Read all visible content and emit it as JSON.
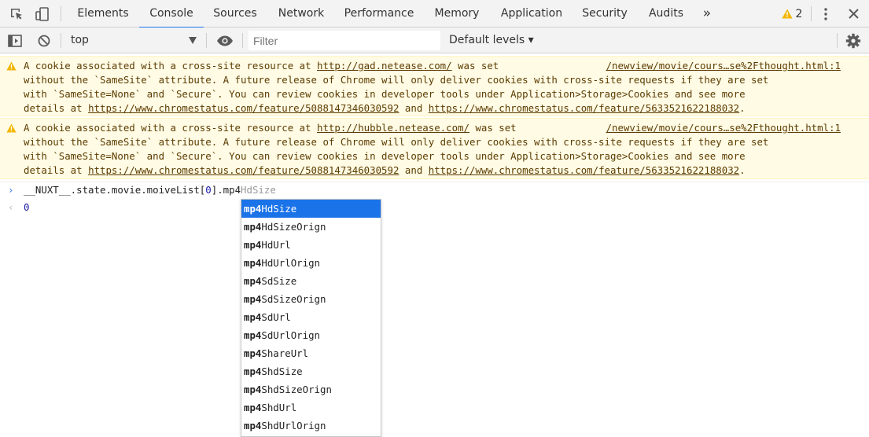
{
  "tabbar": {
    "tabs": [
      {
        "label": "Elements"
      },
      {
        "label": "Console"
      },
      {
        "label": "Sources"
      },
      {
        "label": "Network"
      },
      {
        "label": "Performance"
      },
      {
        "label": "Memory"
      },
      {
        "label": "Application"
      },
      {
        "label": "Security"
      },
      {
        "label": "Audits"
      }
    ],
    "active_tab": "Console",
    "overflow_label": "»",
    "warning_count": "2",
    "colors": {
      "accent": "#1a73e8",
      "warning": "#f2b600"
    }
  },
  "toolbar": {
    "context": "top",
    "filter_placeholder": "Filter",
    "levels_label": "Default levels ▾"
  },
  "warnings": [
    {
      "line1_pre": "A cookie associated with a cross-site resource at ",
      "url": "http://gad.netease.com/",
      "line1_post": " was set ",
      "source": "/newview/movie/cours…se%2Fthought.html:1",
      "line2": "without the `SameSite` attribute. A future release of Chrome will only deliver cookies with cross-site requests if they are set",
      "line3": "with `SameSite=None` and `Secure`. You can review cookies in developer tools under Application>Storage>Cookies and see more",
      "line4_pre": "details at ",
      "link1": "https://www.chromestatus.com/feature/5088147346030592",
      "line4_mid": " and ",
      "link2": "https://www.chromestatus.com/feature/5633521622188032",
      "line4_post": "."
    },
    {
      "line1_pre": "A cookie associated with a cross-site resource at ",
      "url": "http://hubble.netease.com/",
      "line1_post": " was set ",
      "source": "/newview/movie/cours…se%2Fthought.html:1",
      "line2": "without the `SameSite` attribute. A future release of Chrome will only deliver cookies with cross-site requests if they are set",
      "line3": "with `SameSite=None` and `Secure`. You can review cookies in developer tools under Application>Storage>Cookies and see more",
      "line4_pre": "details at ",
      "link1": "https://www.chromestatus.com/feature/5088147346030592",
      "line4_mid": " and ",
      "link2": "https://www.chromestatus.com/feature/5633521622188032",
      "line4_post": "."
    }
  ],
  "console": {
    "input_prefix": "__NUXT__.state.movie.moiveList[",
    "input_index": "0",
    "input_mid": "].mp4",
    "input_ghost": "HdSize",
    "result": "0"
  },
  "autocomplete": {
    "prefix": "mp4",
    "items": [
      "HdSize",
      "HdSizeOrign",
      "HdUrl",
      "HdUrlOrign",
      "SdSize",
      "SdSizeOrign",
      "SdUrl",
      "SdUrlOrign",
      "ShareUrl",
      "ShdSize",
      "ShdSizeOrign",
      "ShdUrl",
      "ShdUrlOrign"
    ],
    "selected_index": 0
  }
}
